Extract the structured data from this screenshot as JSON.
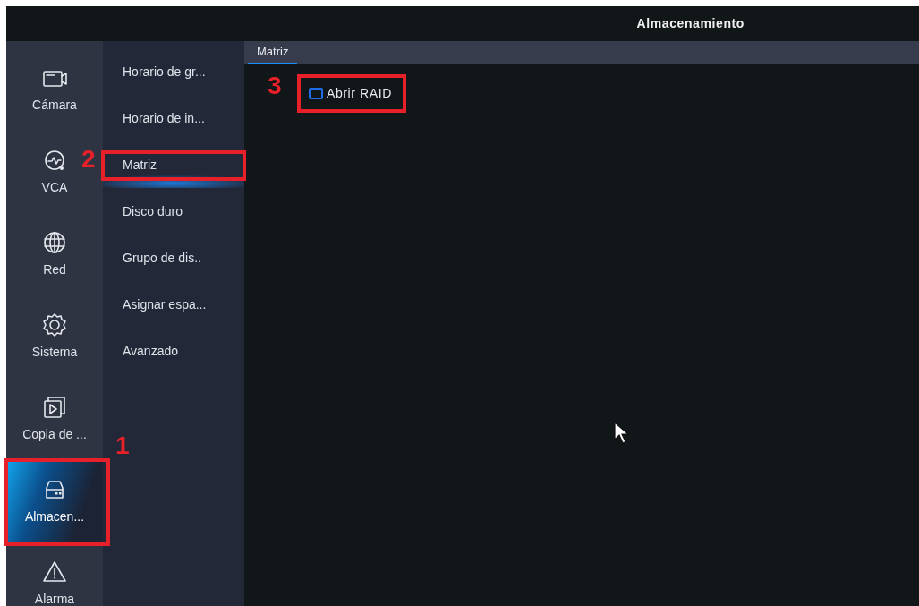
{
  "window": {
    "title": "Almacenamiento"
  },
  "nav": [
    {
      "label": "Cámara",
      "selected": false
    },
    {
      "label": "VCA",
      "selected": false
    },
    {
      "label": "Red",
      "selected": false
    },
    {
      "label": "Sistema",
      "selected": false
    },
    {
      "label": "Copia de ...",
      "selected": false
    },
    {
      "label": "Almacen...",
      "selected": true,
      "annotation": "1"
    },
    {
      "label": "Alarma",
      "selected": false
    }
  ],
  "submenu": [
    {
      "label": "Horario de gr...",
      "selected": false
    },
    {
      "label": "Horario de in...",
      "selected": false
    },
    {
      "label": "Matriz",
      "selected": true,
      "annotation": "2"
    },
    {
      "label": "Disco duro",
      "selected": false
    },
    {
      "label": "Grupo de dis..",
      "selected": false
    },
    {
      "label": "Asignar espa...",
      "selected": false
    },
    {
      "label": "Avanzado",
      "selected": false
    }
  ],
  "tabs": [
    {
      "label": "Matriz",
      "selected": true
    }
  ],
  "options": [
    {
      "label": "Abrir RAID",
      "checked": false,
      "annotation": "3"
    }
  ]
}
